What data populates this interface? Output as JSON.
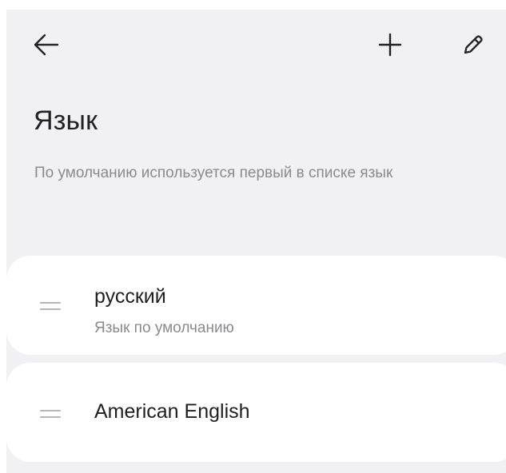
{
  "page": {
    "title": "Язык",
    "description": "По умолчанию используется первый в списке язык"
  },
  "toolbar": {
    "icons": [
      "back-arrow-icon",
      "plus-icon",
      "pencil-icon"
    ]
  },
  "languages": [
    {
      "name": "русский",
      "subtitle": "Язык по умолчанию"
    },
    {
      "name": "American English"
    }
  ],
  "colors": {
    "background": "#f1f1f4",
    "card": "#ffffff",
    "primary_text": "#1f1f1f",
    "secondary_text": "#8a8a8e",
    "handle": "#b5b5ba"
  }
}
